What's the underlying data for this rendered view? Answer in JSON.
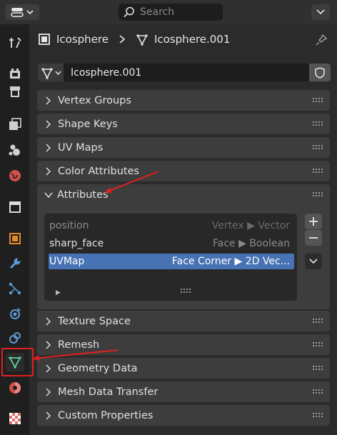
{
  "header": {
    "search_placeholder": "Search"
  },
  "breadcrumb": {
    "object": "Icosphere",
    "mesh": "Icosphere.001"
  },
  "datablock": {
    "name": "Icosphere.001"
  },
  "panels_top": [
    {
      "label": "Vertex Groups",
      "expanded": false
    },
    {
      "label": "Shape Keys",
      "expanded": false
    },
    {
      "label": "UV Maps",
      "expanded": false
    },
    {
      "label": "Color Attributes",
      "expanded": false
    }
  ],
  "attributes": {
    "label": "Attributes",
    "expanded": true,
    "rows": [
      {
        "name": "position",
        "domain_type": "Vertex ▶ Vector",
        "selected": false
      },
      {
        "name": "sharp_face",
        "domain_type": "Face ▶ Boolean",
        "selected": false
      },
      {
        "name": "UVMap",
        "domain_type": "Face Corner ▶ 2D Vec...",
        "selected": true
      }
    ]
  },
  "panels_bottom": [
    {
      "label": "Texture Space",
      "expanded": false
    },
    {
      "label": "Remesh",
      "expanded": false
    },
    {
      "label": "Geometry Data",
      "expanded": false
    },
    {
      "label": "Mesh Data Transfer",
      "expanded": false
    },
    {
      "label": "Custom Properties",
      "expanded": false
    }
  ],
  "sidebar_tabs": [
    "tool",
    "render",
    "output",
    "view-layer",
    "scene",
    "world",
    "collection",
    "object",
    "modifiers",
    "particles",
    "physics",
    "constraints",
    "data",
    "material",
    "texture"
  ],
  "active_tab": "data",
  "colors": {
    "accent_green": "#5fd39a",
    "selection_blue": "#4772b3",
    "annotation_red": "#e02020"
  }
}
